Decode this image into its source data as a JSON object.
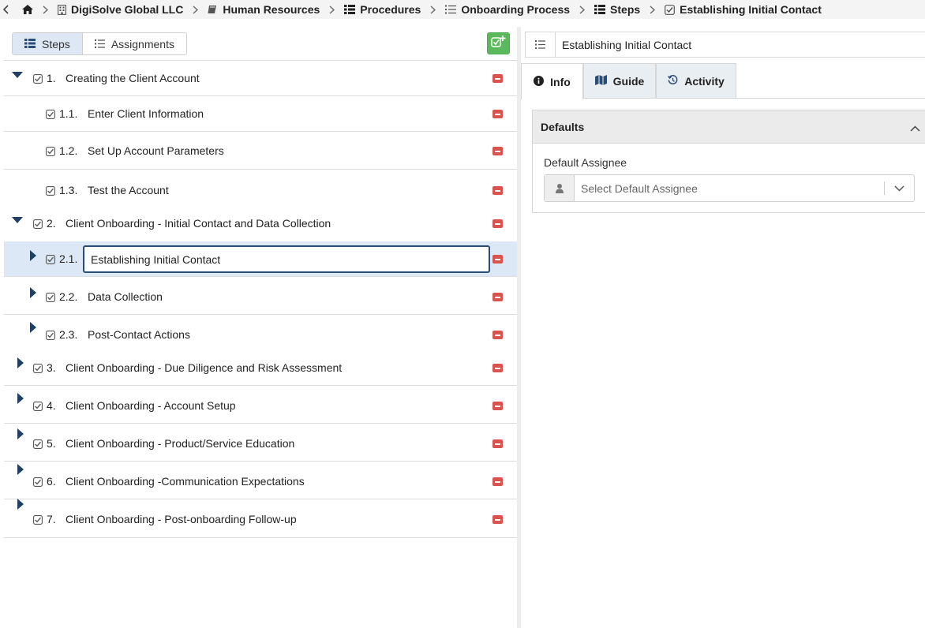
{
  "breadcrumb": {
    "items": [
      {
        "label": "DigiSolve Global LLC",
        "icon": "building-icon"
      },
      {
        "label": "Human Resources",
        "icon": "book-icon"
      },
      {
        "label": "Procedures",
        "icon": "th-list-icon"
      },
      {
        "label": "Onboarding Process",
        "icon": "list-ol-icon"
      },
      {
        "label": "Steps",
        "icon": "th-list-icon"
      },
      {
        "label": "Establishing Initial Contact",
        "icon": "check-square-icon"
      }
    ]
  },
  "left": {
    "tabs": [
      {
        "label": "Steps",
        "active": true
      },
      {
        "label": "Assignments",
        "active": false
      }
    ]
  },
  "steps": [
    {
      "num": "1.",
      "title": "Creating the Client Account",
      "level": 0,
      "expanded": true
    },
    {
      "num": "1.1.",
      "title": "Enter Client Information",
      "level": 1
    },
    {
      "num": "1.2.",
      "title": "Set Up Account Parameters",
      "level": 1
    },
    {
      "num": "1.3.",
      "title": "Test the Account",
      "level": 1
    },
    {
      "num": "2.",
      "title": "Client Onboarding - Initial Contact and Data Collection",
      "level": 0,
      "expanded": true
    },
    {
      "num": "2.1.",
      "title": "Establishing Initial Contact",
      "level": 1,
      "selected": true,
      "editing": true
    },
    {
      "num": "2.2.",
      "title": "Data Collection",
      "level": 1
    },
    {
      "num": "2.3.",
      "title": "Post-Contact Actions",
      "level": 1
    },
    {
      "num": "3.",
      "title": "Client Onboarding - Due Diligence and Risk Assessment",
      "level": 0
    },
    {
      "num": "4.",
      "title": "Client Onboarding - Account Setup",
      "level": 0
    },
    {
      "num": "5.",
      "title": "Client Onboarding - Product/Service Education",
      "level": 0
    },
    {
      "num": "6.",
      "title": "Client Onboarding -Communication Expectations",
      "level": 0
    },
    {
      "num": "7.",
      "title": "Client Onboarding - Post-onboarding Follow-up",
      "level": 0
    }
  ],
  "right": {
    "title": "Establishing Initial Contact",
    "tabs": [
      {
        "label": "Info",
        "icon": "info-circle-icon",
        "active": true
      },
      {
        "label": "Guide",
        "icon": "map-icon",
        "active": false
      },
      {
        "label": "Activity",
        "icon": "history-icon",
        "active": false
      }
    ],
    "panel": {
      "title": "Defaults",
      "field_label": "Default Assignee",
      "select_placeholder": "Select Default Assignee"
    }
  },
  "colors": {
    "accent": "#2a4d76",
    "selected_row": "#dce8f5",
    "remove": "#d9534f",
    "add": "#5cb85c"
  }
}
